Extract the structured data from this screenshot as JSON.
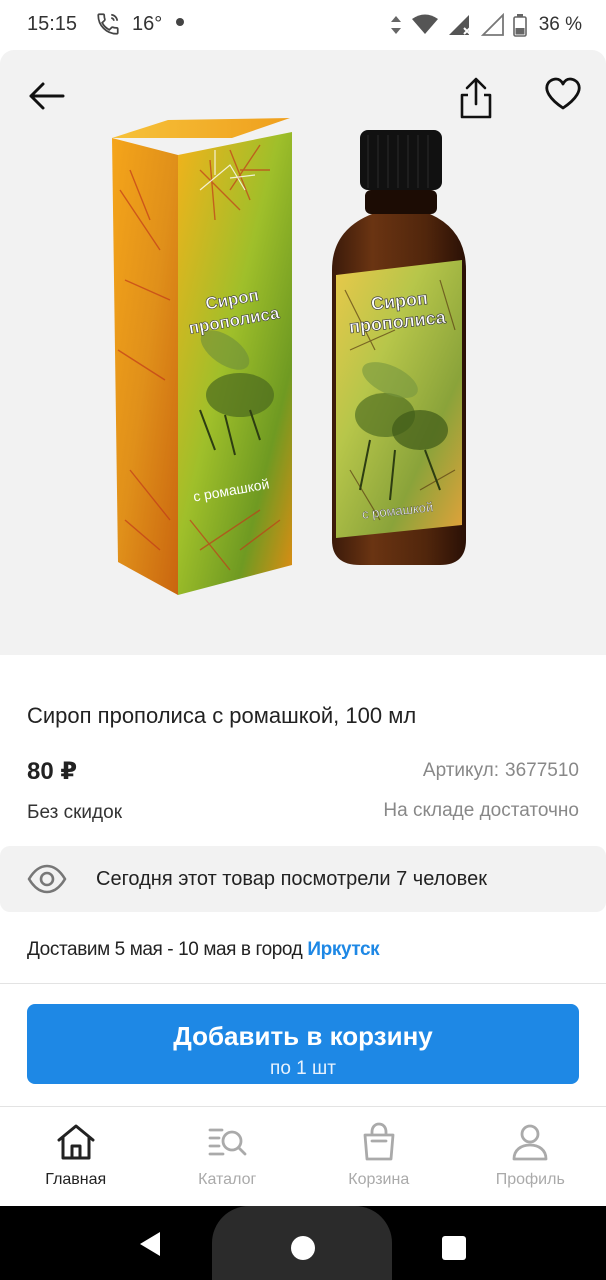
{
  "status_bar": {
    "time": "15:15",
    "temperature": "16°",
    "battery": "36 %",
    "icons": [
      "call-icon",
      "vibrate-icon",
      "wifi-icon",
      "signal-icon",
      "signal-empty-icon",
      "battery-icon"
    ]
  },
  "hero": {
    "package_text": {
      "line1": "Сироп",
      "line2": "прополиса",
      "line3": "с ромашкой"
    },
    "icons": [
      "back-arrow-icon",
      "share-icon",
      "heart-icon"
    ]
  },
  "product": {
    "title": "Сироп прополиса с ромашкой, 100 мл",
    "price": "80 ₽",
    "sku_label": "Артикул:",
    "sku_value": "3677510",
    "discount": "Без скидок",
    "stock": "На складе достаточно"
  },
  "views": {
    "text": "Сегодня этот товар посмотрели 7 человек",
    "icon": "eye-icon"
  },
  "delivery": {
    "text": "Доставим 5 мая - 10 мая в город",
    "city": "Иркутск"
  },
  "add_to_cart": {
    "label": "Добавить в корзину",
    "sub": "по 1 шт"
  },
  "bottom_nav": {
    "items": [
      {
        "label": "Главная",
        "icon": "home-icon",
        "active": true
      },
      {
        "label": "Каталог",
        "icon": "catalog-search-icon",
        "active": false
      },
      {
        "label": "Корзина",
        "icon": "shopping-bag-icon",
        "active": false
      },
      {
        "label": "Профиль",
        "icon": "profile-icon",
        "active": false
      }
    ]
  },
  "colors": {
    "accent": "#1e88e5",
    "active_nav": "#222222",
    "inactive_nav": "#aaaaaa"
  }
}
